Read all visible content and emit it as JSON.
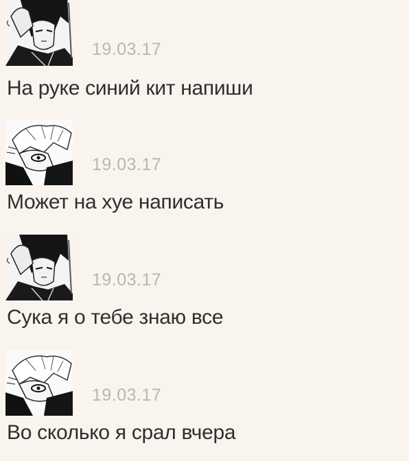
{
  "messages": [
    {
      "avatar": "dark-haired-anime-character-avatar",
      "date": "19.03.17",
      "text": "На руке синий кит напиши"
    },
    {
      "avatar": "white-haired-anime-character-avatar",
      "date": "19.03.17",
      "text": "Может на хуе написать"
    },
    {
      "avatar": "dark-haired-anime-character-avatar",
      "date": "19.03.17",
      "text": "Сука я о тебе знаю все"
    },
    {
      "avatar": "white-haired-anime-character-avatar",
      "date": "19.03.17",
      "text": "Во сколько я срал вчера"
    }
  ],
  "colors": {
    "background": "#faf4ef",
    "date_text": "#b9b6b3",
    "message_text": "#2e2e2e"
  }
}
